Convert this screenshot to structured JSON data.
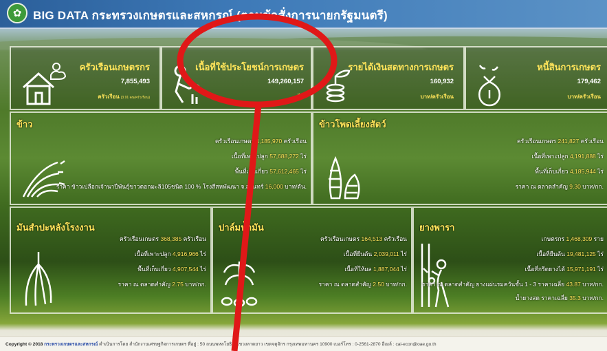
{
  "header": {
    "logo_icon": "ministry-logo-icon",
    "title": "BIG DATA กระทรวงเกษตรและสหกรณ์ (ตามข้อสั่งการนายกรัฐมนตรี)"
  },
  "top_cards": [
    {
      "title": "ครัวเรือนเกษตรกร",
      "value": "7,855,493",
      "unit": "ครัวเรือน",
      "subunit": "(3.91 คน/ครัวเรือน)",
      "icon": "house-weather-icon"
    },
    {
      "title": "เนื้อที่ใช้ประโยชน์การเกษตร",
      "value": "149,260,157",
      "unit": "ไร่",
      "subunit": "",
      "icon": "farmer-planting-icon"
    },
    {
      "title": "รายได้เงินสดทางการเกษตร",
      "value": "160,932",
      "unit": "บาท/ครัวเรือน",
      "subunit": "",
      "icon": "coin-plant-icon"
    },
    {
      "title": "หนี้สินการเกษตร",
      "value": "179,462",
      "unit": "บาท/ครัวเรือน",
      "subunit": "",
      "icon": "money-bag-icon"
    }
  ],
  "rice": {
    "title": "ข้าว",
    "icon": "rice-stalk-icon",
    "lines": [
      {
        "label": "ครัวเรือนเกษตร",
        "value": "4,185,970",
        "suffix": "ครัวเรือน"
      },
      {
        "label": "เนื้อที่เพาะปลูก",
        "value": "57,688,272",
        "suffix": "ไร่"
      },
      {
        "label": "พื้นที่เก็บเกี่ยว",
        "value": "57,612,465",
        "suffix": "ไร่"
      },
      {
        "label": "ราคา ข้าวเปลือกเจ้านาปีพันธุ์ขาวดอกมะลิ105ชนิด 100 % โรงสีสหพัฒนา จ.สุรินทร์",
        "value": "16,000",
        "suffix": "บาท/ตัน."
      }
    ]
  },
  "corn": {
    "title": "ข้าวโพดเลี้ยงสัตว์",
    "icon": "corn-cob-icon",
    "lines": [
      {
        "label": "ครัวเรือนเกษตร",
        "value": "241,827",
        "suffix": "ครัวเรือน"
      },
      {
        "label": "เนื้อที่เพาะปลูก",
        "value": "4,191,888",
        "suffix": "ไร่"
      },
      {
        "label": "พื้นที่เก็บเกี่ยว",
        "value": "4,185,944",
        "suffix": "ไร่"
      },
      {
        "label": "ราคา ณ ตลาดสำคัญ",
        "value": "9.30",
        "suffix": "บาท/กก."
      }
    ]
  },
  "cassava": {
    "title": "มันสำปะหลังโรงงาน",
    "icon": "cassava-root-icon",
    "lines": [
      {
        "label": "ครัวเรือนเกษตร",
        "value": "368,385",
        "suffix": "ครัวเรือน"
      },
      {
        "label": "เนื้อที่เพาะปลูก",
        "value": "4,916,966",
        "suffix": "ไร่"
      },
      {
        "label": "พื้นที่เก็บเกี่ยว",
        "value": "4,907,544",
        "suffix": "ไร่"
      },
      {
        "label": "ราคา ณ ตลาดสำคัญ",
        "value": "2.75",
        "suffix": "บาท/กก."
      }
    ]
  },
  "palm": {
    "title": "ปาล์มน้ำมัน",
    "icon": "oil-palm-icon",
    "lines": [
      {
        "label": "ครัวเรือนเกษตร",
        "value": "164,513",
        "suffix": "ครัวเรือน"
      },
      {
        "label": "เนื้อที่ยืนต้น",
        "value": "2,039,011",
        "suffix": "ไร่"
      },
      {
        "label": "เนื้อที่ให้ผล",
        "value": "1,887,044",
        "suffix": "ไร่"
      },
      {
        "label": "ราคา ณ ตลาดสำคัญ",
        "value": "2.50",
        "suffix": "บาท/กก."
      }
    ]
  },
  "rubber": {
    "title": "ยางพารา",
    "icon": "rubber-tapper-icon",
    "lines": [
      {
        "label": "เกษตรกร",
        "value": "1,468,309",
        "suffix": "ราย"
      },
      {
        "label": "เนื้อที่ยืนต้น",
        "value": "19,481,125",
        "suffix": "ไร่"
      },
      {
        "label": "เนื้อที่กรีดยางได้",
        "value": "15,971,191",
        "suffix": "ไร่"
      },
      {
        "label": "ราคา ณ ตลาดสำคัญ ยางแผ่นรมควันชั้น 1 - 3 ราคาเฉลี่ย",
        "value": "43.87",
        "suffix": "บาท/กก."
      },
      {
        "label": "น้ำยางสด ราคาเฉลี่ย",
        "value": "35.3",
        "suffix": "บาท/กก."
      }
    ]
  },
  "footer": {
    "copyright": "Copyright © 2018",
    "link": "กระทรวงเกษตรและสหกรณ์",
    "rest": "ดำเนินการโดย สำนักงานเศรษฐกิจการเกษตร ที่อยู่ : 50 ถนนพหลโยธิน แขวงลาดยาว เขตจตุจักร กรุงเทพมหานคร 10900 เบอร์โทร : 0-2561-2870 อีเมล์ : cai-econ@oae.go.th"
  },
  "annotation": {
    "color": "#e01818"
  }
}
